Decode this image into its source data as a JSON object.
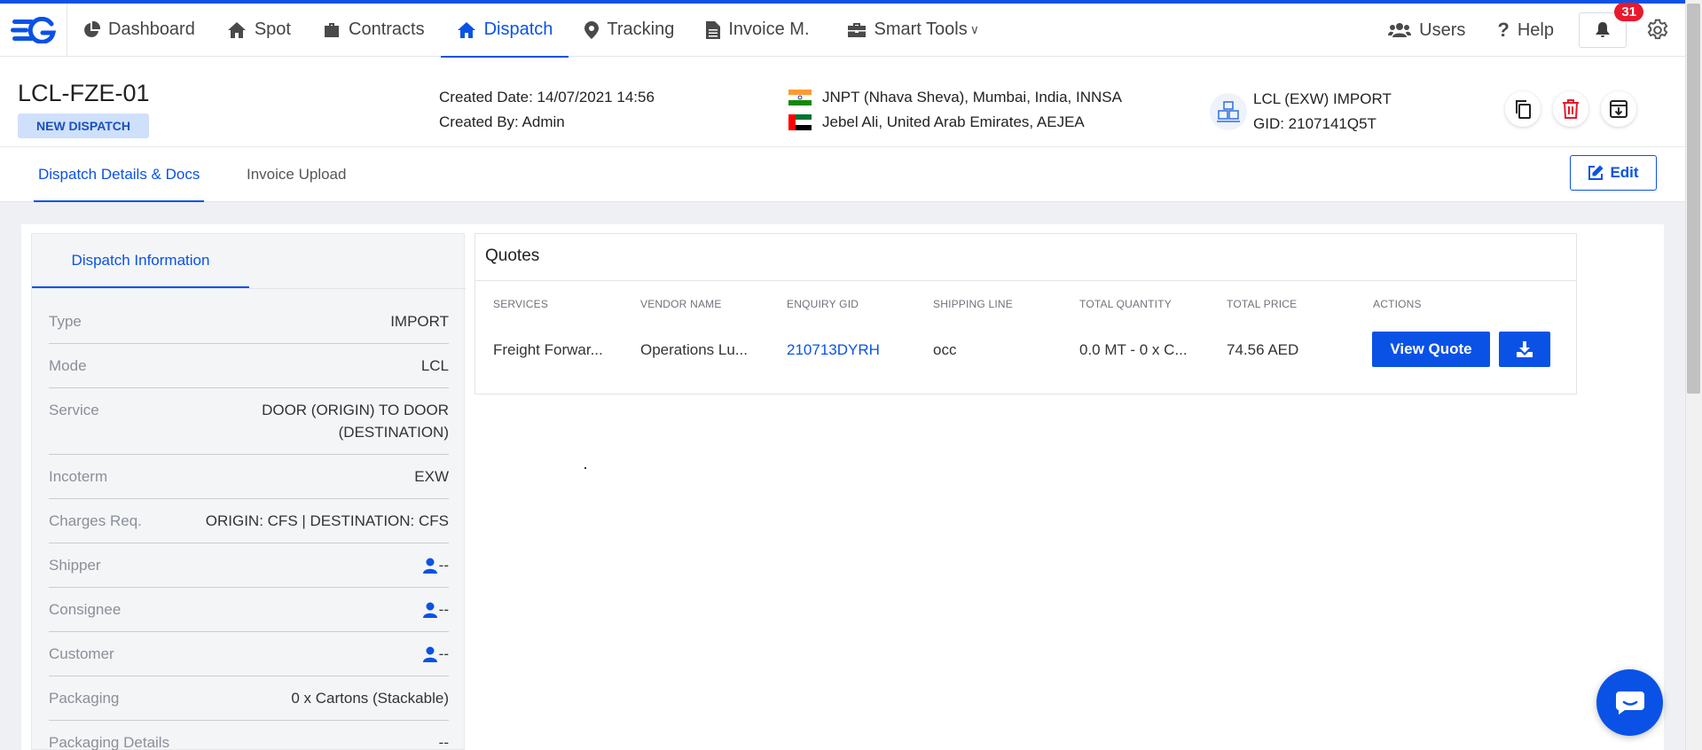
{
  "nav": {
    "items": [
      {
        "label": "Dashboard",
        "icon": "pie-chart-icon",
        "active": false
      },
      {
        "label": "Spot",
        "icon": "home-icon",
        "active": false
      },
      {
        "label": "Contracts",
        "icon": "briefcase-icon",
        "active": false
      },
      {
        "label": "Dispatch",
        "icon": "home-icon",
        "active": true
      },
      {
        "label": "Tracking",
        "icon": "map-pin-icon",
        "active": false
      },
      {
        "label": "Invoice M.",
        "icon": "document-icon",
        "active": false
      },
      {
        "label": "Smart Tools",
        "icon": "toolbox-icon",
        "active": false
      }
    ],
    "users_label": "Users",
    "help_label": "Help",
    "notification_count": "31",
    "accent_color": "#0a52e6",
    "badge_color": "#e8192c"
  },
  "header": {
    "dispatch_id": "LCL-FZE-01",
    "status": "NEW DISPATCH",
    "created_date": "Created Date: 14/07/2021 14:56",
    "created_by": "Created By: Admin",
    "origin": "JNPT (Nhava Sheva), Mumbai, India, INNSA",
    "destination": "Jebel Ali, United Arab Emirates, AEJEA",
    "shipment_type": "LCL (EXW) IMPORT",
    "gid": "GID: 2107141Q5T"
  },
  "tabs": {
    "details": "Dispatch Details & Docs",
    "invoice": "Invoice Upload",
    "edit": "Edit"
  },
  "info": {
    "tab_label": "Dispatch Information",
    "rows": [
      {
        "label": "Type",
        "value": "IMPORT"
      },
      {
        "label": "Mode",
        "value": "LCL"
      },
      {
        "label": "Service",
        "value": "DOOR (ORIGIN) TO DOOR (DESTINATION)"
      },
      {
        "label": "Incoterm",
        "value": "EXW"
      },
      {
        "label": "Charges Req.",
        "value": "ORIGIN: CFS | DESTINATION: CFS"
      },
      {
        "label": "Shipper",
        "value": "--"
      },
      {
        "label": "Consignee",
        "value": "--"
      },
      {
        "label": "Customer",
        "value": "--"
      },
      {
        "label": "Packaging",
        "value": "0 x Cartons (Stackable)"
      },
      {
        "label": "Packaging Details",
        "value": "--"
      }
    ]
  },
  "quotes": {
    "title": "Quotes",
    "columns": [
      "SERVICES",
      "VENDOR NAME",
      "ENQUIRY GID",
      "SHIPPING LINE",
      "TOTAL QUANTITY",
      "TOTAL PRICE",
      "ACTIONS"
    ],
    "row": {
      "services": "Freight Forwar...",
      "vendor": "Operations Lu...",
      "enquiry_gid": "210713DYRH",
      "shipping_line": "occ",
      "quantity": "0.0 MT - 0 x C...",
      "price": "74.56 AED"
    },
    "view_quote_label": "View Quote"
  }
}
